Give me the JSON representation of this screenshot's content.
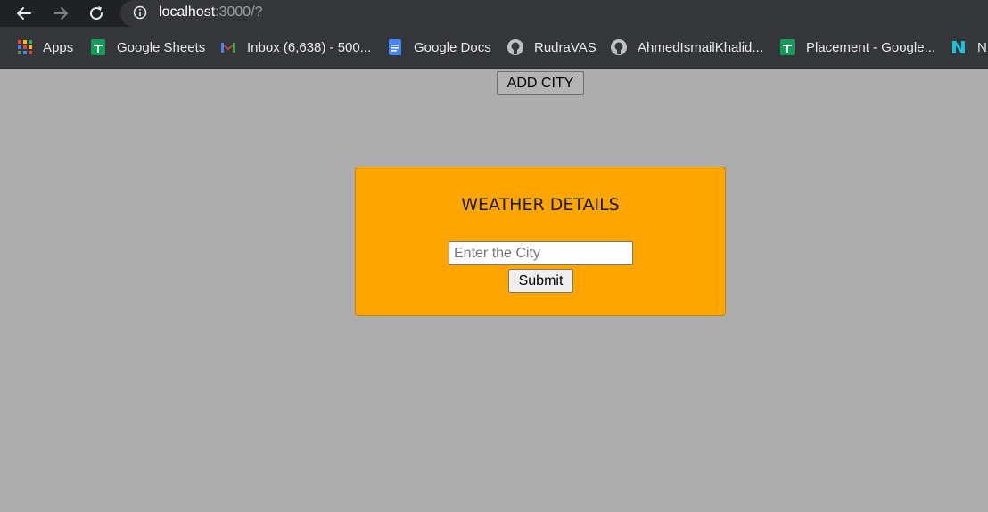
{
  "browser": {
    "url_host": "localhost",
    "url_rest": ":3000/?",
    "bookmarks": [
      {
        "label": "Apps",
        "icon": "apps-grid-icon"
      },
      {
        "label": "Google Sheets",
        "icon": "google-sheets-icon"
      },
      {
        "label": "Inbox (6,638) - 500...",
        "icon": "gmail-icon"
      },
      {
        "label": "Google Docs",
        "icon": "google-docs-icon"
      },
      {
        "label": "RudraVAS",
        "icon": "github-icon"
      },
      {
        "label": "AhmedIsmailKhalid...",
        "icon": "github-icon"
      },
      {
        "label": "Placement - Google...",
        "icon": "google-sheets-icon"
      },
      {
        "label": "N",
        "icon": "notion-like-icon"
      }
    ]
  },
  "page": {
    "add_city_label": "ADD CITY",
    "card": {
      "title": "WEATHER DETAILS",
      "city_placeholder": "Enter the City",
      "city_value": "",
      "submit_label": "Submit"
    }
  },
  "colors": {
    "page_background": "#adadad",
    "card_background": "#ffa500",
    "chrome_dark": "#202124",
    "bookmarks_bar": "#35363a"
  }
}
